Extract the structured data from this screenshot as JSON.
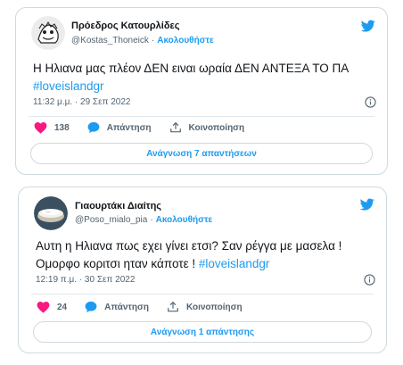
{
  "tweets": [
    {
      "author_name": "Πρόεδρος Κατουρλίδες",
      "handle": "@Kostas_Thoneick",
      "follow_label": "Ακολουθήστε",
      "text": "Η Ηλιανα μας πλέον ΔΕΝ ειναι ωραία ΔΕΝ ΑΝΤΕΞΑ ΤΟ ΠΑ ",
      "hashtag": "#loveislandgr",
      "time": "11:32 μ.μ.",
      "date": "29 Σεπ 2022",
      "likes": "138",
      "reply_label": "Απάντηση",
      "share_label": "Κοινοποίηση",
      "read_replies_label": "Ανάγνωση 7 απαντήσεων"
    },
    {
      "author_name": "Γιαουρτάκι Διαίτης",
      "handle": "@Poso_mialo_pia",
      "follow_label": "Ακολουθήστε",
      "text": "Αυτη η Ηλιανα πως εχει γίνει ετσι? Σαν ρέγγα με μασελα ! Ομορφο κοριτσι ηταν κάποτε ! ",
      "hashtag": "#loveislandgr",
      "time": "12:19 π.μ.",
      "date": "30 Σεπ 2022",
      "likes": "24",
      "reply_label": "Απάντηση",
      "share_label": "Κοινοποίηση",
      "read_replies_label": "Ανάγνωση 1 απάντησης"
    }
  ],
  "colors": {
    "accent": "#1d9bf0",
    "like": "#f91880",
    "muted": "#536471",
    "border": "#cfd9de"
  },
  "icons": {
    "brand": "twitter-bird-icon",
    "like": "heart-icon",
    "reply": "speech-bubble-icon",
    "share": "share-upload-icon",
    "info": "info-icon"
  }
}
